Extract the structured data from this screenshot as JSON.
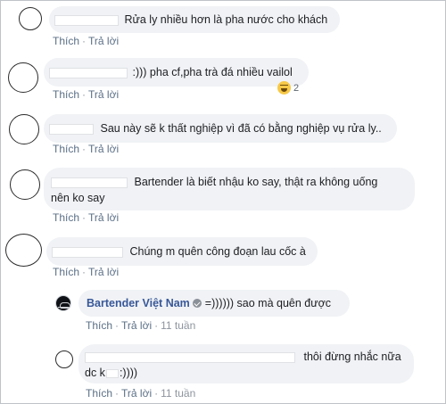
{
  "actions": {
    "like": "Thích",
    "reply": "Trả lời",
    "separator": "·"
  },
  "comments": [
    {
      "text": "Rửa ly nhiều hơn là pha nước cho khách"
    },
    {
      "text": ":))) pha cf,pha trà đá nhiều vailol",
      "reaction_count": "2",
      "reaction_icon": "haha-emoji-icon"
    },
    {
      "text": "Sau này sẽ k thất nghiệp vì đã có bằng nghiệp vụ rửa ly.."
    },
    {
      "text_line1": "Bartender là biết nhậu ko say, thật ra không uống",
      "text_line2": "nên ko say"
    },
    {
      "text": "Chúng m quên công đoạn lau cốc à"
    }
  ],
  "replies": [
    {
      "author": "Bartender Việt Nam",
      "text": "=)))))) sao mà quên được",
      "time": "11 tuần",
      "verified_icon": "verified-badge-icon"
    },
    {
      "text_line1": "thôi đừng nhắc nữa",
      "text_line2_prefix": "dc k",
      "text_line2_suffix": ":))))",
      "time": "11 tuần"
    }
  ]
}
